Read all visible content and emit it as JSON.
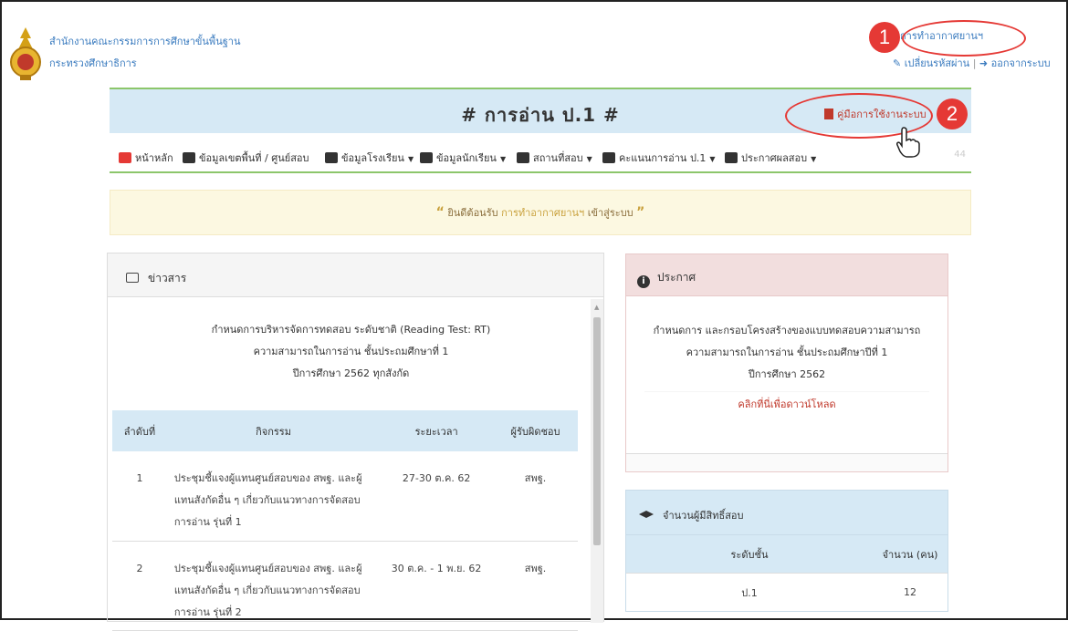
{
  "header": {
    "org_line1": "สำนักงานคณะกรรมการการศึกษาขั้นพื้นฐาน",
    "org_line2": "กระทรวงศึกษาธิการ",
    "user_name": "การทำอากาศยานฯ",
    "change_password": "เปลี่ยนรหัสผ่าน",
    "separator": "|",
    "logout": "ออกจากระบบ"
  },
  "badges": {
    "one": "1",
    "two": "2"
  },
  "title": {
    "text": "# การอ่าน ป.1 #",
    "manual_link": "คู่มือการใช้งานระบบ"
  },
  "nav": {
    "items": [
      {
        "label": "หน้าหลัก",
        "icon": "home-icon"
      },
      {
        "label": "ข้อมูลเขตพื้นที่ / ศูนย์สอบ",
        "icon": "bank-icon"
      },
      {
        "label": "ข้อมูลโรงเรียน",
        "icon": "briefcase-icon"
      },
      {
        "label": "ข้อมูลนักเรียน",
        "icon": "graduation-cap-icon"
      },
      {
        "label": "สถานที่สอบ",
        "icon": "table-icon"
      },
      {
        "label": "คะแนนการอ่าน ป.1",
        "icon": "download-icon"
      },
      {
        "label": "ประกาศผลสอบ",
        "icon": "bullhorn-icon"
      }
    ],
    "caret": "▼",
    "right_text": "44"
  },
  "welcome": {
    "prefix": "ยินดีต้อนรับ",
    "name": "การทำอากาศยานฯ",
    "suffix": "เข้าสู่ระบบ",
    "open_quote": "“",
    "close_quote": "”"
  },
  "news": {
    "heading": "ข่าวสาร",
    "title_line1": "กำหนดการบริหารจัดการทดสอบ ระดับชาติ (Reading Test: RT)",
    "title_line2": "ความสามารถในการอ่าน ชั้นประถมศึกษาที่ 1",
    "title_line3": "ปีการศึกษา 2562 ทุกสังกัด",
    "columns": [
      "ลำดับที่",
      "กิจกรรม",
      "ระยะเวลา",
      "ผู้รับผิดชอบ"
    ],
    "rows": [
      {
        "no": "1",
        "activity": "ประชุมชี้แจงผู้แทนศูนย์สอบของ สพฐ. และผู้แทนสังกัดอื่น ๆ เกี่ยวกับแนวทางการจัดสอบการอ่าน รุ่นที่ 1",
        "period": "27-30 ต.ค. 62",
        "owner": "สพฐ."
      },
      {
        "no": "2",
        "activity": "ประชุมชี้แจงผู้แทนศูนย์สอบของ สพฐ. และผู้แทนสังกัดอื่น ๆ เกี่ยวกับแนวทางการจัดสอบการอ่าน รุ่นที่ 2",
        "period": "30 ต.ค. - 1 พ.ย. 62",
        "owner": "สพฐ."
      }
    ]
  },
  "announce": {
    "heading": "ประกาศ",
    "line1": "กำหนดการ และกรอบโครงสร้างของแบบทดสอบความสามารถ",
    "line2": "ความสามารถในการอ่าน ชั้นประถมศึกษาปีที่ 1",
    "line3": "ปีการศึกษา 2562",
    "download": "คลิกที่นี่เพื่อดาวน์โหลด"
  },
  "exam": {
    "heading": "จำนวนผู้มีสิทธิ์สอบ",
    "columns": [
      "ระดับชั้น",
      "จำนวน (คน)"
    ],
    "rows": [
      {
        "level": "ป.1",
        "count": "12"
      }
    ]
  },
  "colors": {
    "accent_red": "#e53935",
    "title_bg": "#d6e9f5",
    "link": "#3a7bbf"
  }
}
